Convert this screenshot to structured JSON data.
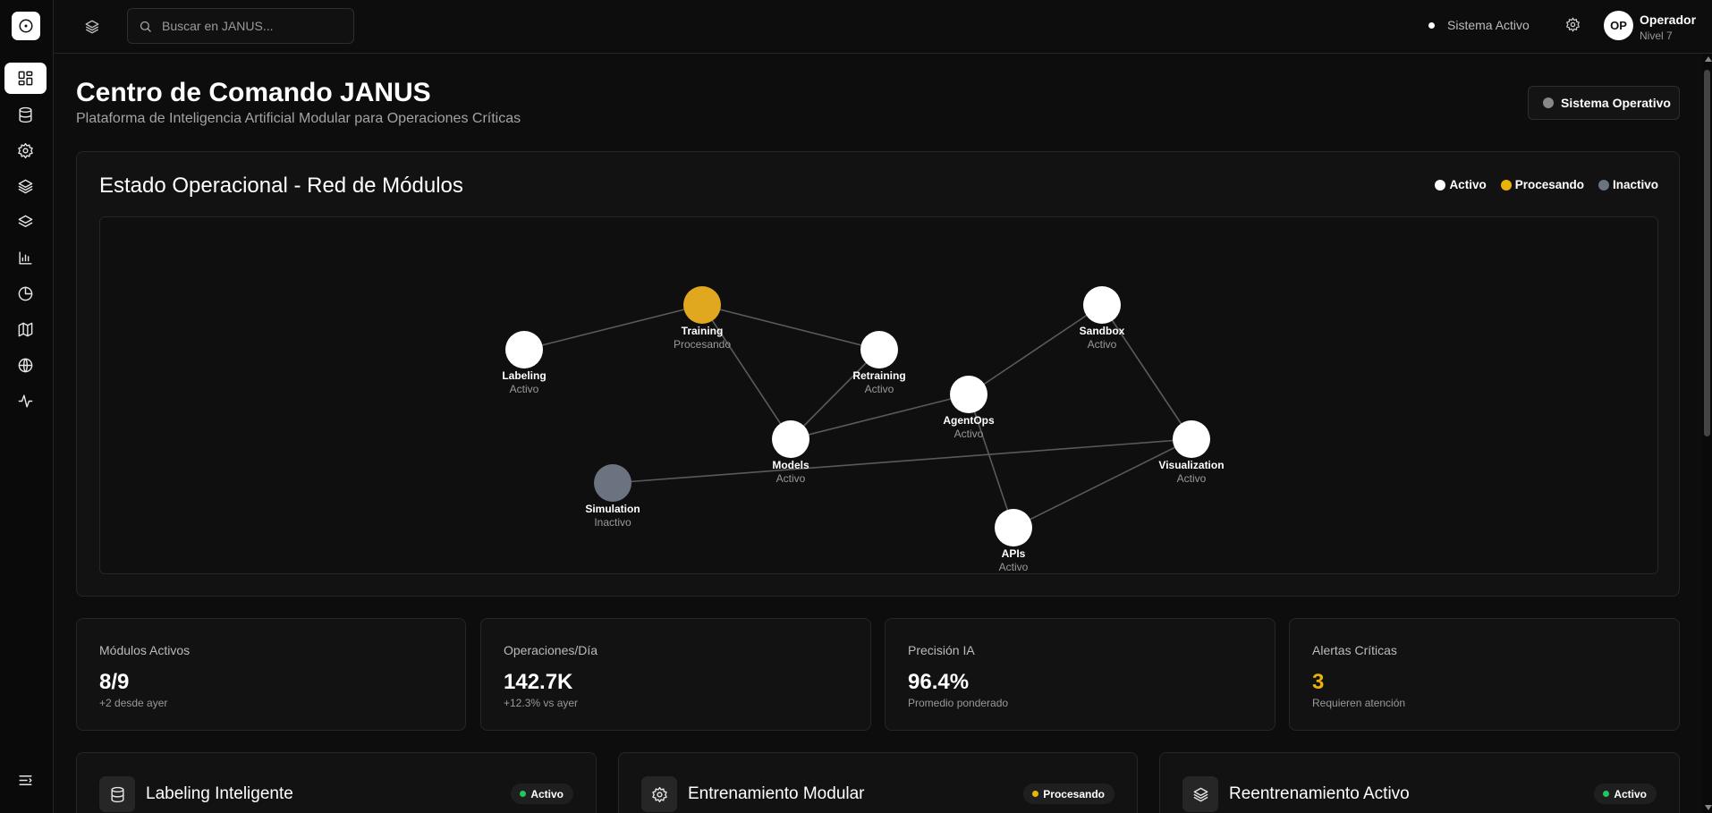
{
  "topbar": {
    "search_placeholder": "Buscar en JANUS...",
    "system_status": "Sistema Activo",
    "user_initials": "OP",
    "user_name": "Operador",
    "user_level": "Nivel 7"
  },
  "sidebar": {
    "items": [
      {
        "icon": "dashboard-icon",
        "active": true
      },
      {
        "icon": "database-icon",
        "active": false
      },
      {
        "icon": "gear-icon",
        "active": false
      },
      {
        "icon": "layers-icon",
        "active": false
      },
      {
        "icon": "stack-icon",
        "active": false
      },
      {
        "icon": "bar-chart-icon",
        "active": false
      },
      {
        "icon": "pie-chart-icon",
        "active": false
      },
      {
        "icon": "map-icon",
        "active": false
      },
      {
        "icon": "globe-icon",
        "active": false
      },
      {
        "icon": "activity-icon",
        "active": false
      }
    ],
    "footer_icon": "collapse-menu-icon"
  },
  "header": {
    "title": "Centro de Comando JANUS",
    "subtitle": "Plataforma de Inteligencia Artificial Modular para Operaciones Críticas",
    "status_badge": "Sistema Operativo"
  },
  "network": {
    "title": "Estado Operacional - Red de Módulos",
    "legend": [
      {
        "label": "Activo",
        "color": "#ffffff"
      },
      {
        "label": "Procesando",
        "color": "#eab308"
      },
      {
        "label": "Inactivo",
        "color": "#6b7280"
      }
    ],
    "nodes": [
      {
        "id": "labeling",
        "name": "Labeling",
        "status": "Activo",
        "color": "#ffffff"
      },
      {
        "id": "training",
        "name": "Training",
        "status": "Procesando",
        "color": "#e0a81e"
      },
      {
        "id": "retraining",
        "name": "Retraining",
        "status": "Activo",
        "color": "#ffffff"
      },
      {
        "id": "sandbox",
        "name": "Sandbox",
        "status": "Activo",
        "color": "#ffffff"
      },
      {
        "id": "agentops",
        "name": "AgentOps",
        "status": "Activo",
        "color": "#ffffff"
      },
      {
        "id": "models",
        "name": "Models",
        "status": "Activo",
        "color": "#ffffff"
      },
      {
        "id": "visualization",
        "name": "Visualization",
        "status": "Activo",
        "color": "#ffffff"
      },
      {
        "id": "simulation",
        "name": "Simulation",
        "status": "Inactivo",
        "color": "#6b7280"
      },
      {
        "id": "apis",
        "name": "APIs",
        "status": "Activo",
        "color": "#ffffff"
      }
    ],
    "edges": [
      [
        "labeling",
        "training"
      ],
      [
        "training",
        "retraining"
      ],
      [
        "training",
        "models"
      ],
      [
        "retraining",
        "models"
      ],
      [
        "models",
        "agentops"
      ],
      [
        "agentops",
        "sandbox"
      ],
      [
        "sandbox",
        "visualization"
      ],
      [
        "agentops",
        "apis"
      ],
      [
        "apis",
        "visualization"
      ],
      [
        "simulation",
        "visualization"
      ]
    ]
  },
  "stats": [
    {
      "label": "Módulos Activos",
      "value": "8/9",
      "sub": "+2 desde ayer",
      "value_color": "#ffffff"
    },
    {
      "label": "Operaciones/Día",
      "value": "142.7K",
      "sub": "+12.3% vs ayer",
      "value_color": "#ffffff"
    },
    {
      "label": "Precisión IA",
      "value": "96.4%",
      "sub": "Promedio ponderado",
      "value_color": "#ffffff"
    },
    {
      "label": "Alertas Críticas",
      "value": "3",
      "sub": "Requieren atención",
      "value_color": "#eab308"
    }
  ],
  "modules": [
    {
      "title": "Labeling Inteligente",
      "status": "Activo",
      "status_color": "#22c55e",
      "icon": "database-icon"
    },
    {
      "title": "Entrenamiento Modular",
      "status": "Procesando",
      "status_color": "#eab308",
      "icon": "gear-icon"
    },
    {
      "title": "Reentrenamiento Activo",
      "status": "Activo",
      "status_color": "#22c55e",
      "icon": "layers-icon"
    }
  ]
}
